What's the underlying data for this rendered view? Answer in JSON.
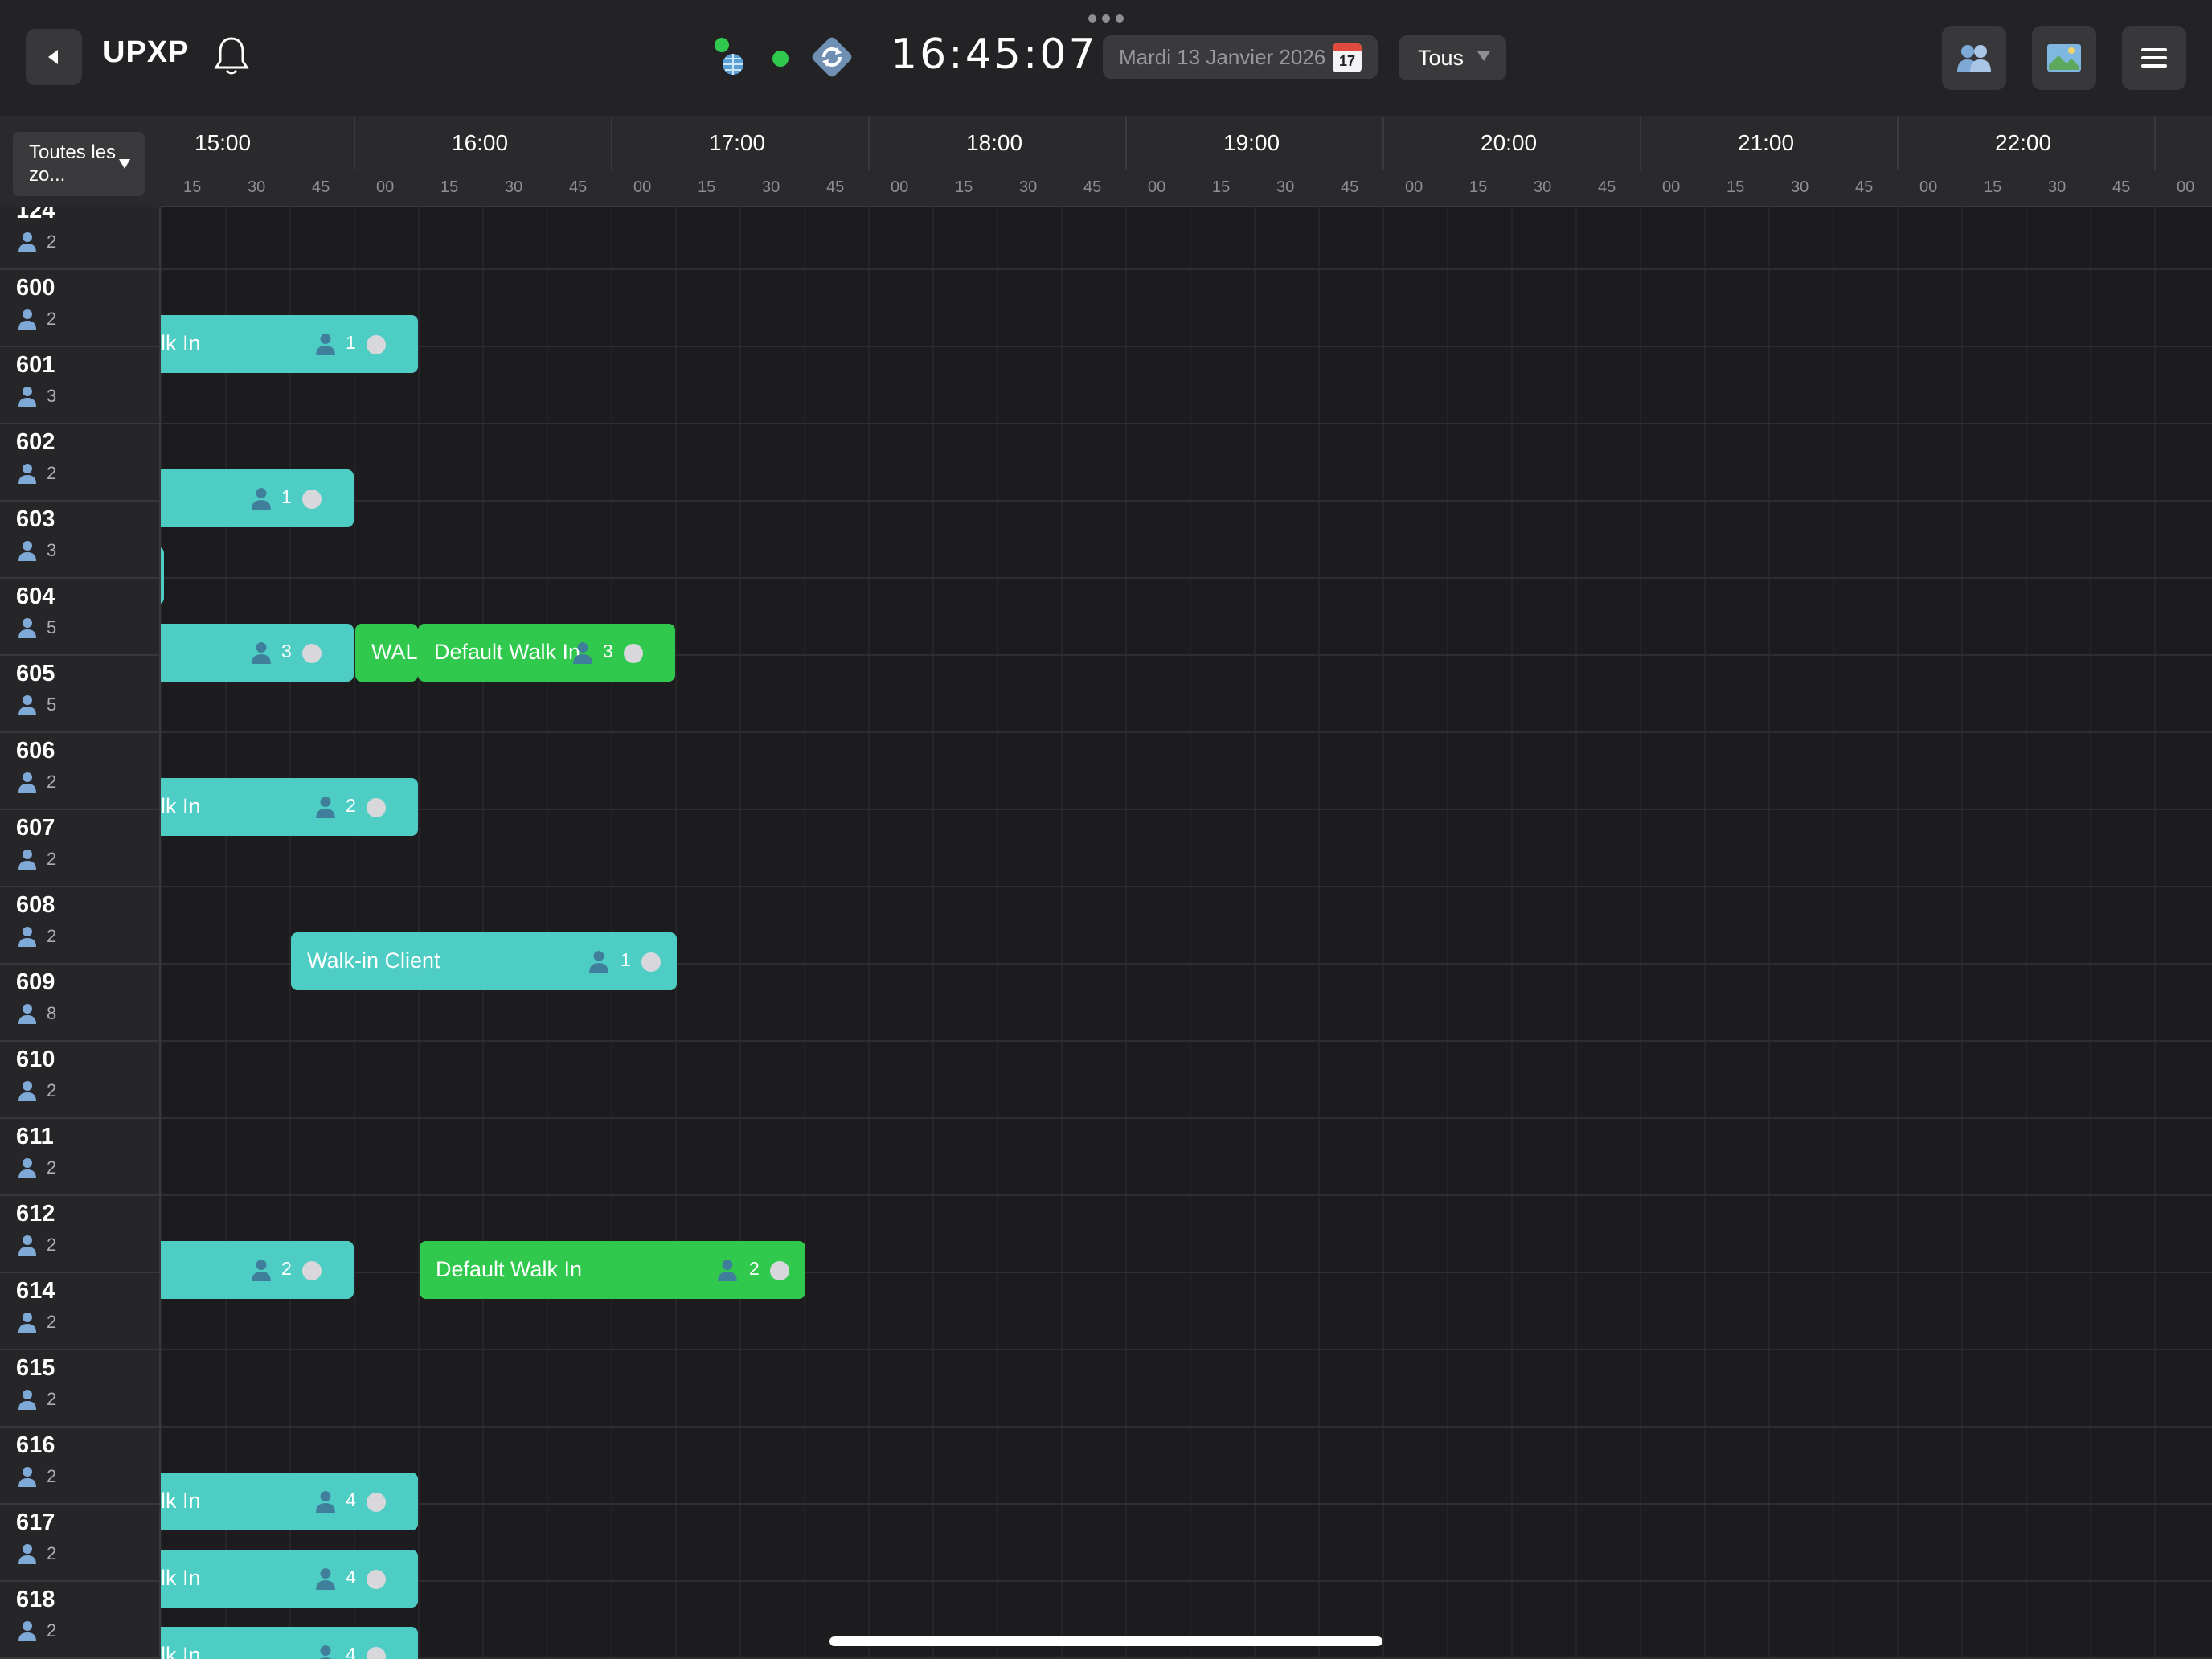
{
  "header": {
    "app_title": "UPXP",
    "time": "16:45:07",
    "date": "Mardi 13 Janvier 2026",
    "calendar_day": "17",
    "filter_value": "Tous"
  },
  "zone_filter": {
    "label": "Toutes les zo..."
  },
  "timeline": {
    "hours": [
      "15:00",
      "16:00",
      "17:00",
      "18:00",
      "19:00",
      "20:00",
      "21:00",
      "22:00"
    ],
    "minute_ticks": [
      "15",
      "30",
      "45",
      "00",
      "15",
      "30",
      "45",
      "00",
      "15",
      "30",
      "45",
      "00",
      "15",
      "30",
      "45",
      "00",
      "15",
      "30",
      "45",
      "00",
      "15",
      "30",
      "45",
      "00",
      "15",
      "30",
      "45",
      "00",
      "15",
      "30",
      "45",
      "00"
    ]
  },
  "tables": [
    {
      "number": "124",
      "capacity": "2"
    },
    {
      "number": "600",
      "capacity": "2"
    },
    {
      "number": "601",
      "capacity": "3"
    },
    {
      "number": "602",
      "capacity": "2"
    },
    {
      "number": "603",
      "capacity": "3"
    },
    {
      "number": "604",
      "capacity": "5"
    },
    {
      "number": "605",
      "capacity": "5"
    },
    {
      "number": "606",
      "capacity": "2"
    },
    {
      "number": "607",
      "capacity": "2"
    },
    {
      "number": "608",
      "capacity": "2"
    },
    {
      "number": "609",
      "capacity": "8"
    },
    {
      "number": "610",
      "capacity": "2"
    },
    {
      "number": "611",
      "capacity": "2"
    },
    {
      "number": "612",
      "capacity": "2"
    },
    {
      "number": "614",
      "capacity": "2"
    },
    {
      "number": "615",
      "capacity": "2"
    },
    {
      "number": "616",
      "capacity": "2"
    },
    {
      "number": "617",
      "capacity": "2"
    },
    {
      "number": "618",
      "capacity": "2"
    }
  ],
  "bookings": [
    {
      "table": "600",
      "name": "lk In",
      "guests": "1",
      "color": "teal"
    },
    {
      "table": "602",
      "name": "",
      "guests": "1",
      "color": "teal"
    },
    {
      "table": "603",
      "name": "",
      "guests": "",
      "color": "teal"
    },
    {
      "table": "604",
      "name": "",
      "guests": "3",
      "color": "teal"
    },
    {
      "table": "604",
      "name": "WAL",
      "guests": "",
      "color": "green"
    },
    {
      "table": "604",
      "name": "Default Walk In",
      "guests": "3",
      "color": "green"
    },
    {
      "table": "606",
      "name": "lk In",
      "guests": "2",
      "color": "teal"
    },
    {
      "table": "608",
      "name": "Walk-in Client",
      "guests": "1",
      "color": "teal"
    },
    {
      "table": "612",
      "name": "",
      "guests": "2",
      "color": "teal"
    },
    {
      "table": "612",
      "name": "Default Walk In",
      "guests": "2",
      "color": "green"
    },
    {
      "table": "616",
      "name": "lk In",
      "guests": "4",
      "color": "teal"
    },
    {
      "table": "617",
      "name": "lk In",
      "guests": "4",
      "color": "teal"
    },
    {
      "table": "618",
      "name": "lk In",
      "guests": "4",
      "color": "teal"
    }
  ],
  "colors": {
    "teal": "#4ecdc4",
    "green": "#30c94d",
    "background": "#1c1c1e",
    "status_green": "#30c94d"
  },
  "icons": {
    "back": "back-arrow-icon",
    "bell": "bell-icon",
    "network": "network-status-icon",
    "online": "online-dot-icon",
    "sync": "sync-icon",
    "calendar": "calendar-icon",
    "guests": "guests-icon",
    "floor_plan": "floor-plan-icon",
    "menu": "hamburger-menu-icon"
  }
}
